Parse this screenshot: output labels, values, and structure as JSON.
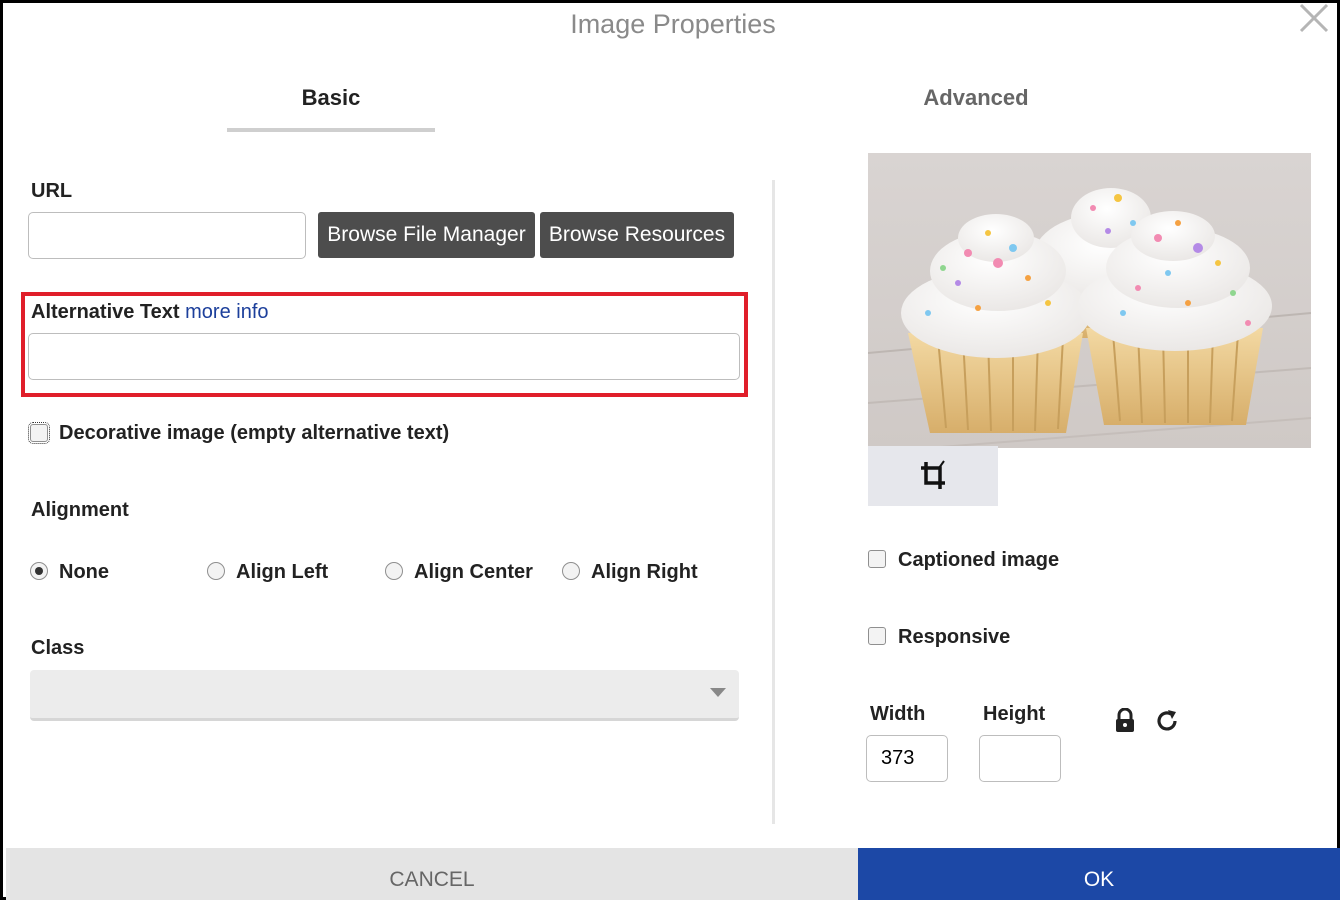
{
  "dialog": {
    "title": "Image Properties",
    "tabs": {
      "basic": "Basic",
      "advanced": "Advanced"
    }
  },
  "basic": {
    "url_label": "URL",
    "url_value": "",
    "browse_file_manager": "Browse File Manager",
    "browse_resources": "Browse Resources",
    "alt_text_label": "Alternative Text",
    "alt_text_link": "more info",
    "alt_text_value": "",
    "decorative_label": "Decorative image (empty alternative text)",
    "alignment_label": "Alignment",
    "alignment_options": [
      "None",
      "Align Left",
      "Align Center",
      "Align Right"
    ],
    "alignment_selected": "None",
    "class_label": "Class",
    "class_value": ""
  },
  "preview": {
    "image": "cupcakes with frosting and sprinkles",
    "crop_icon": "crop-icon"
  },
  "options": {
    "captioned_label": "Captioned image",
    "responsive_label": "Responsive"
  },
  "dimensions": {
    "width_label": "Width",
    "width_value": "373",
    "height_label": "Height",
    "height_value": "",
    "lock_icon": "lock-icon",
    "reset_icon": "refresh-icon"
  },
  "footer": {
    "cancel": "CANCEL",
    "ok": "OK"
  },
  "colors": {
    "highlight_border": "#e01e2a",
    "ok_button": "#1c48a6",
    "dark_button": "#4d4d4d",
    "link": "#1c3f9b"
  }
}
